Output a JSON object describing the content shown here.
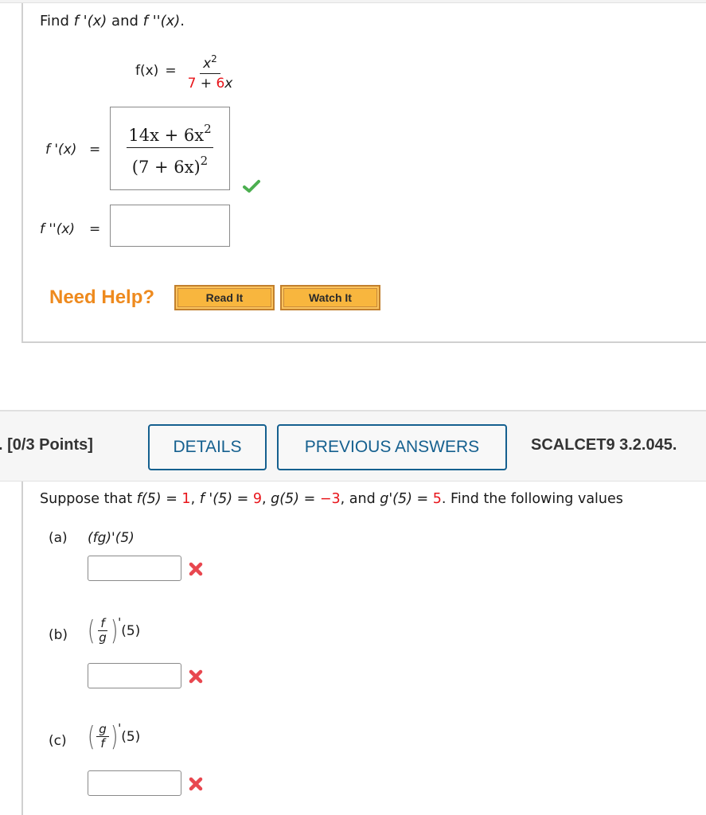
{
  "question1": {
    "prompt": {
      "find": "Find ",
      "fprime": "f '(x)",
      "and": " and ",
      "fdoubleprime": "f ''(x)",
      "period": "."
    },
    "function": {
      "lhs": "f(x)",
      "equals": "=",
      "numerator_base": "x",
      "numerator_exp": "2",
      "denominator_a": "7",
      "denominator_plus": " + ",
      "denominator_b": "6",
      "denominator_var": "x"
    },
    "fprime_label": "f '(x)",
    "fprime_equals": "=",
    "fprime_answer": {
      "numerator": "14x + 6x",
      "numerator_exp": "2",
      "denominator": "(7 + 6x)",
      "denominator_exp": "2",
      "status": "correct"
    },
    "fdoubleprime_label": "f ''(x)",
    "fdoubleprime_equals": "=",
    "fdoubleprime_value": "",
    "need_help": "Need Help?",
    "read_it": "Read It",
    "watch_it": "Watch It"
  },
  "question2": {
    "points": ". [0/3 Points]",
    "details_button": "DETAILS",
    "previous_answers_button": "PREVIOUS ANSWERS",
    "reference": "SCALCET9 3.2.045.",
    "prompt": {
      "p1": "Suppose that ",
      "f5": "f(5)",
      "eq": " = ",
      "f5_val": "1",
      "c1": ", ",
      "fp5": "f '(5)",
      "fp5_val": "9",
      "c2": ", ",
      "g5": "g(5)",
      "g5_val": "−3",
      "c3": ", and ",
      "gp5": "g'(5)",
      "gp5_val": "5",
      "tail": ". Find the following values"
    },
    "parts": [
      {
        "label": "(a)",
        "expr": "(fg)'(5)",
        "value": "",
        "status": "incorrect"
      },
      {
        "label": "(b)",
        "num": "f",
        "den": "g",
        "prime": "'",
        "arg": "(5)",
        "value": "",
        "status": "incorrect"
      },
      {
        "label": "(c)",
        "num": "g",
        "den": "f",
        "prime": "'",
        "arg": "(5)",
        "value": "",
        "status": "incorrect"
      }
    ]
  },
  "colors": {
    "given_value": "#e8141a",
    "help_text": "#ee8a1e",
    "help_button": "#f8b63e",
    "header_button": "#15608f",
    "correct": "#4caf50",
    "incorrect": "#e8474f"
  }
}
